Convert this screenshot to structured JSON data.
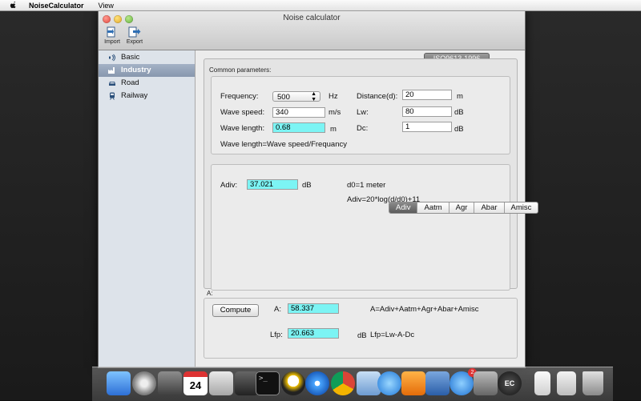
{
  "menubar": {
    "app_name": "NoiseCalculator",
    "items": [
      "View"
    ]
  },
  "window": {
    "title": "Noise calculator",
    "toolbar": {
      "import_label": "Import",
      "export_label": "Export"
    }
  },
  "sidebar": {
    "items": [
      {
        "label": "Basic",
        "icon": "speaker-icon"
      },
      {
        "label": "Industry",
        "icon": "factory-icon",
        "selected": true
      },
      {
        "label": "Road",
        "icon": "car-icon"
      },
      {
        "label": "Railway",
        "icon": "train-icon"
      }
    ]
  },
  "standard_tab": "ISO9613-1996",
  "common": {
    "heading": "Common parameters:",
    "frequency": {
      "label": "Frequency:",
      "value": "500",
      "unit": "Hz"
    },
    "wave_speed": {
      "label": "Wave speed:",
      "value": "340",
      "unit": "m/s"
    },
    "wave_length": {
      "label": "Wave length:",
      "value": "0.68",
      "unit": "m"
    },
    "distance": {
      "label": "Distance(d):",
      "value": "20",
      "unit": "m"
    },
    "lw": {
      "label": "Lw:",
      "value": "80",
      "unit": "dB"
    },
    "dc": {
      "label": "Dc:",
      "value": "1",
      "unit": "dB"
    },
    "formula": "Wave length=Wave speed/Frequancy"
  },
  "tabs": [
    "Adiv",
    "Aatm",
    "Agr",
    "Abar",
    "Amisc"
  ],
  "active_tab": "Adiv",
  "adiv": {
    "label": "Adiv:",
    "value": "37.021",
    "unit": "dB",
    "note1": "d0=1 meter",
    "note2": "Adiv=20*log(d/d0)+11"
  },
  "result": {
    "heading": "A:",
    "compute_label": "Compute",
    "a_label": "A:",
    "a_value": "58.337",
    "a_formula": "A=Adiv+Aatm+Agr+Abar+Amisc",
    "lfp_label": "Lfp:",
    "lfp_value": "20.663",
    "lfp_unit": "dB",
    "lfp_formula": "Lfp=Lw-A-Dc"
  },
  "dock": {
    "calendar_day": "24",
    "badge_count": "2",
    "ec_label": "EC"
  },
  "colors": {
    "highlight_field": "#7cf4f4",
    "sidebar_selection": "#8797ae"
  }
}
